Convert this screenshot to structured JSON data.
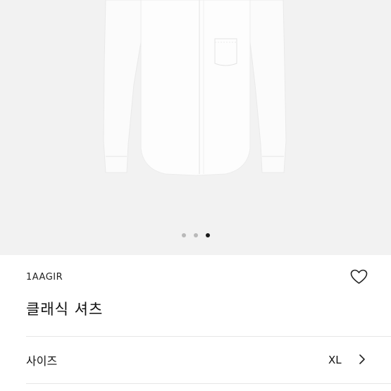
{
  "product": {
    "sku": "1AAGIR",
    "title": "클래식 셔츠",
    "size_label": "사이즈",
    "size_value": "XL"
  },
  "gallery": {
    "image_subject": "white shirt",
    "slides": 3,
    "active_index": 2
  },
  "icons": {
    "wishlist": "heart-outline-icon",
    "size_row": "chevron-right-icon"
  },
  "colors": {
    "gallery_bg": "#f2f2f2",
    "dot_inactive": "#b9b9b9",
    "dot_active": "#1a1a1a"
  }
}
